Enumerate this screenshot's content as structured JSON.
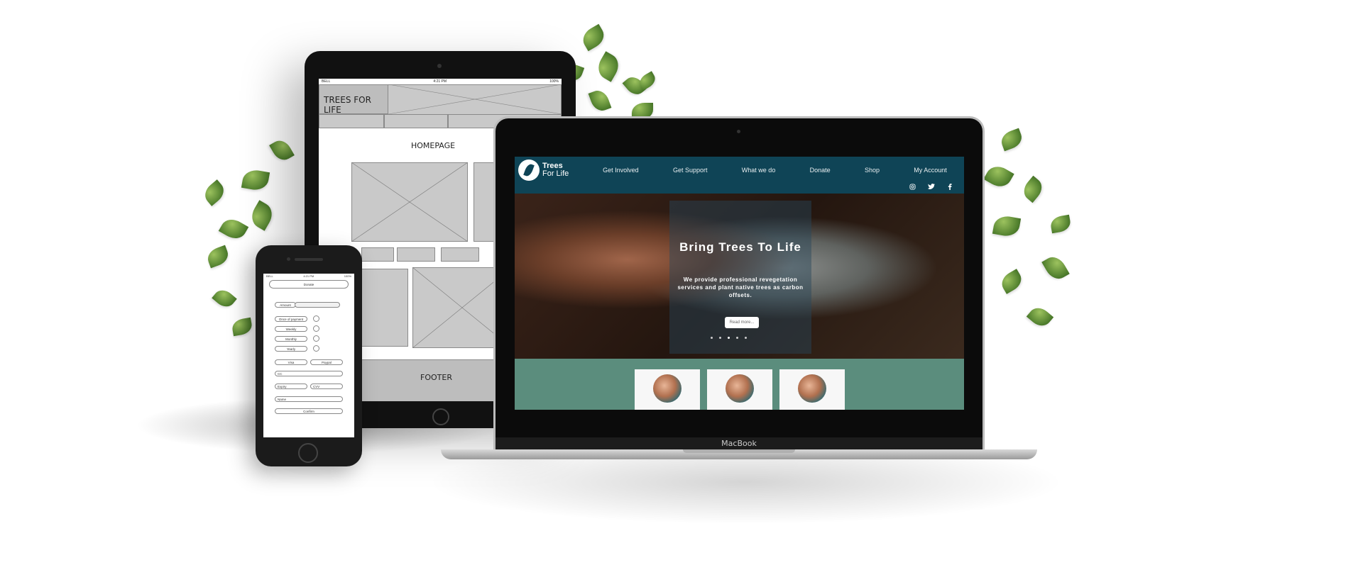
{
  "tablet": {
    "status_left": "BELL",
    "status_time": "4:21 PM",
    "status_right": "100%",
    "brand": "TREES FOR LIFE",
    "page_title": "HOMEPAGE",
    "footer": "FOOTER"
  },
  "phone": {
    "status_left": "BELL",
    "status_time": "4:21 PM",
    "status_right": "100%",
    "donate_button": "Donate",
    "amount_label": "Amount",
    "payment_label": "Once of payment",
    "weekly": "Weekly",
    "monthly": "Monthly",
    "yearly": "Yearly",
    "visa": "Visa",
    "paypal": "Paypal",
    "cc_placeholder": "CC",
    "expiry_placeholder": "Expiry",
    "cvv_placeholder": "CVV",
    "name_placeholder": "Name",
    "confirm_button": "Confirm"
  },
  "laptop": {
    "device_label": "MacBook",
    "brand_line1": "Trees",
    "brand_line2": "For Life",
    "nav": [
      "Get Involved",
      "Get Support",
      "What we do",
      "Donate",
      "Shop",
      "My Account"
    ],
    "hero_title": "Bring Trees To Life",
    "hero_subtitle": "We provide professional revegetation services and plant native trees as carbon offsets.",
    "hero_button": "Read more...",
    "social_icons": [
      "instagram-icon",
      "twitter-icon",
      "facebook-icon"
    ]
  },
  "colors": {
    "nav_bg": "#0f4456",
    "band_bg": "#5b8d7d"
  }
}
